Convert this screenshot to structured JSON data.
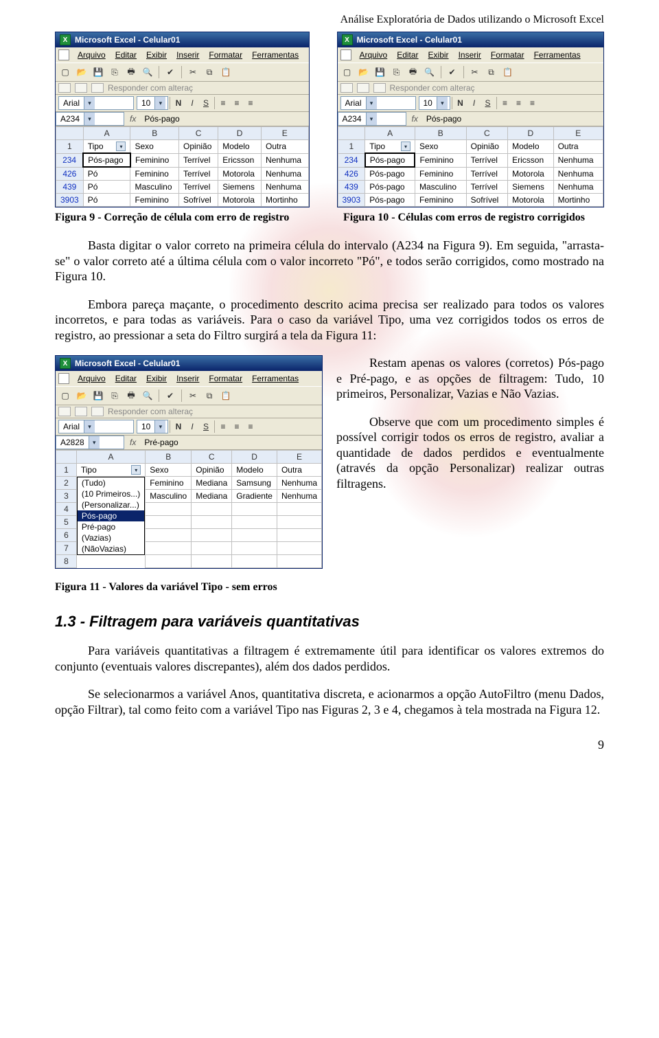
{
  "page_header": "Análise Exploratória de Dados utilizando o Microsoft Excel",
  "excel": {
    "window_title": "Microsoft Excel - Celular01",
    "menus": [
      "Arquivo",
      "Editar",
      "Exibir",
      "Inserir",
      "Formatar",
      "Ferramentas"
    ],
    "reply_label": "Responder com alteraç",
    "font_name": "Arial",
    "font_size": "10",
    "fmt_btn_bold": "N",
    "fmt_btn_italic": "I",
    "fmt_btn_under": "S",
    "name_box_fig9": "A234",
    "fx_value_fig9": "Pós-pago",
    "columns": [
      "A",
      "B",
      "C",
      "D",
      "E"
    ],
    "header_row": [
      "Tipo",
      "Sexo",
      "Opinião",
      "Modelo",
      "Outra"
    ],
    "header_row_num": "1"
  },
  "fig9": {
    "caption": "Figura 9 - Correção de célula com erro de registro",
    "rows": [
      {
        "n": "234",
        "cells": [
          "Pós-pago",
          "Feminino",
          "Terrível",
          "Ericsson",
          "Nenhuma"
        ],
        "sel": true
      },
      {
        "n": "426",
        "cells": [
          "Pó",
          "Feminino",
          "Terrível",
          "Motorola",
          "Nenhuma"
        ]
      },
      {
        "n": "439",
        "cells": [
          "Pó",
          "Masculino",
          "Terrível",
          "Siemens",
          "Nenhuma"
        ]
      },
      {
        "n": "3903",
        "cells": [
          "Pó",
          "Feminino",
          "Sofrível",
          "Motorola",
          "Mortinho"
        ]
      }
    ]
  },
  "fig10": {
    "caption": "Figura 10 - Células com erros de registro corrigidos",
    "rows": [
      {
        "n": "234",
        "cells": [
          "Pós-pago",
          "Feminino",
          "Terrível",
          "Ericsson",
          "Nenhuma"
        ],
        "sel": true
      },
      {
        "n": "426",
        "cells": [
          "Pós-pago",
          "Feminino",
          "Terrível",
          "Motorola",
          "Nenhuma"
        ]
      },
      {
        "n": "439",
        "cells": [
          "Pós-pago",
          "Masculino",
          "Terrível",
          "Siemens",
          "Nenhuma"
        ]
      },
      {
        "n": "3903",
        "cells": [
          "Pós-pago",
          "Feminino",
          "Sofrível",
          "Motorola",
          "Mortinho"
        ]
      }
    ]
  },
  "fig11": {
    "caption": "Figura 11 - Valores da variável Tipo - sem erros",
    "name_box": "A2828",
    "fx_value": "Pré-pago",
    "rows": [
      {
        "n": "2",
        "cells": [
          "",
          "Feminino",
          "Mediana",
          "Samsung",
          "Nenhuma"
        ]
      },
      {
        "n": "3",
        "cells": [
          "",
          "Masculino",
          "Mediana",
          "Gradiente",
          "Nenhuma"
        ]
      }
    ],
    "filter_options": [
      "(Tudo)",
      "(10 Primeiros...)",
      "(Personalizar...)",
      "Pós-pago",
      "Pré-pago",
      "(Vazias)",
      "(NãoVazias)"
    ],
    "selected_option_index": 3,
    "trailing_rows": [
      "4",
      "5",
      "6",
      "7",
      "8"
    ]
  },
  "para1": "Basta digitar o valor correto na primeira célula do intervalo (A234 na Figura 9). Em seguida, \"arrasta-se\" o valor correto até a última célula com o valor incorreto \"Pó\", e todos serão corrigidos, como mostrado na Figura 10.",
  "para2": "Embora pareça maçante, o procedimento descrito acima precisa ser realizado para todos os valores incorretos, e para todas as variáveis. Para o caso da variável Tipo, uma vez corrigidos todos os erros de registro, ao pressionar a seta do Filtro surgirá a tela da Figura 11:",
  "side_para1": "Restam apenas os valores (corretos) Pós-pago e Pré-pago, e as opções de filtragem: Tudo, 10 primeiros, Personalizar, Vazias e Não Vazias.",
  "side_para2": "Observe que com um procedimento simples é possível corrigir todos os erros de registro, avaliar a quantidade de dados perdidos e eventualmente (através da opção Personalizar) realizar outras filtragens.",
  "section_heading": "1.3 - Filtragem para variáveis quantitativas",
  "para3": "Para variáveis quantitativas a filtragem é extremamente útil para identificar os valores extremos do conjunto (eventuais valores discrepantes), além dos dados perdidos.",
  "para4": "Se selecionarmos a variável Anos, quantitativa discreta, e acionarmos a opção AutoFiltro (menu Dados, opção Filtrar), tal como feito com a variável Tipo nas Figuras 2, 3 e 4, chegamos à tela mostrada na Figura 12.",
  "page_number": "9"
}
